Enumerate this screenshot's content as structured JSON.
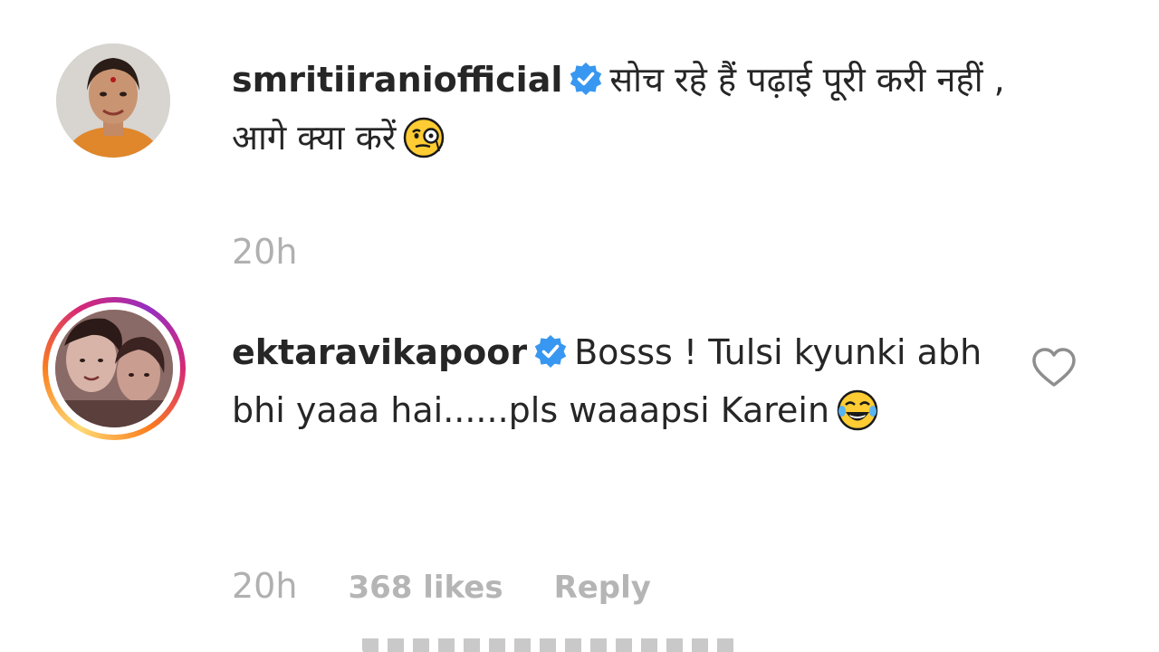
{
  "comments": [
    {
      "username": "smritiiraniofficial",
      "verified": true,
      "text": "सोच रहे हैं पढ़ाई पूरी करी नहीं , आगे क्या करें",
      "emoji": "face-with-monocle",
      "time": "20h"
    },
    {
      "username": "ektaravikapoor",
      "verified": true,
      "text": "Bosss ! Tulsi kyunki abh bhi yaaa hai......pls waaapsi Karein",
      "emoji": "face-with-tears-of-joy",
      "time": "20h",
      "likes": "368 likes",
      "reply_label": "Reply",
      "has_story_ring": true
    }
  ],
  "icons": {
    "verified_badge": "verified-badge-icon",
    "like": "heart-outline-icon"
  },
  "colors": {
    "verified": "#3897f0",
    "meta_text": "#b0b0b0",
    "story_ring": [
      "#feda75",
      "#fa7e1e",
      "#d62976",
      "#962fbf"
    ]
  }
}
